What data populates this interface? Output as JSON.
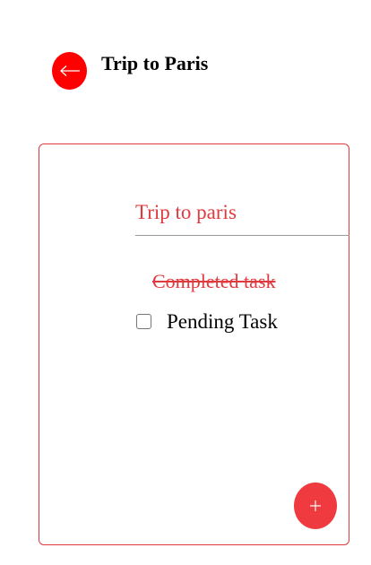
{
  "header": {
    "title": "Trip to Paris",
    "back_icon": "arrow-left-icon"
  },
  "card": {
    "list_title": "Trip to paris",
    "tasks": [
      {
        "label": "Completed task",
        "done": true
      },
      {
        "label": "Pending Task",
        "done": false
      }
    ],
    "add_icon": "plus-icon"
  },
  "colors": {
    "accent": "#ff0000",
    "card_accent": "#e03a3e",
    "fab": "#ef3a3f"
  }
}
